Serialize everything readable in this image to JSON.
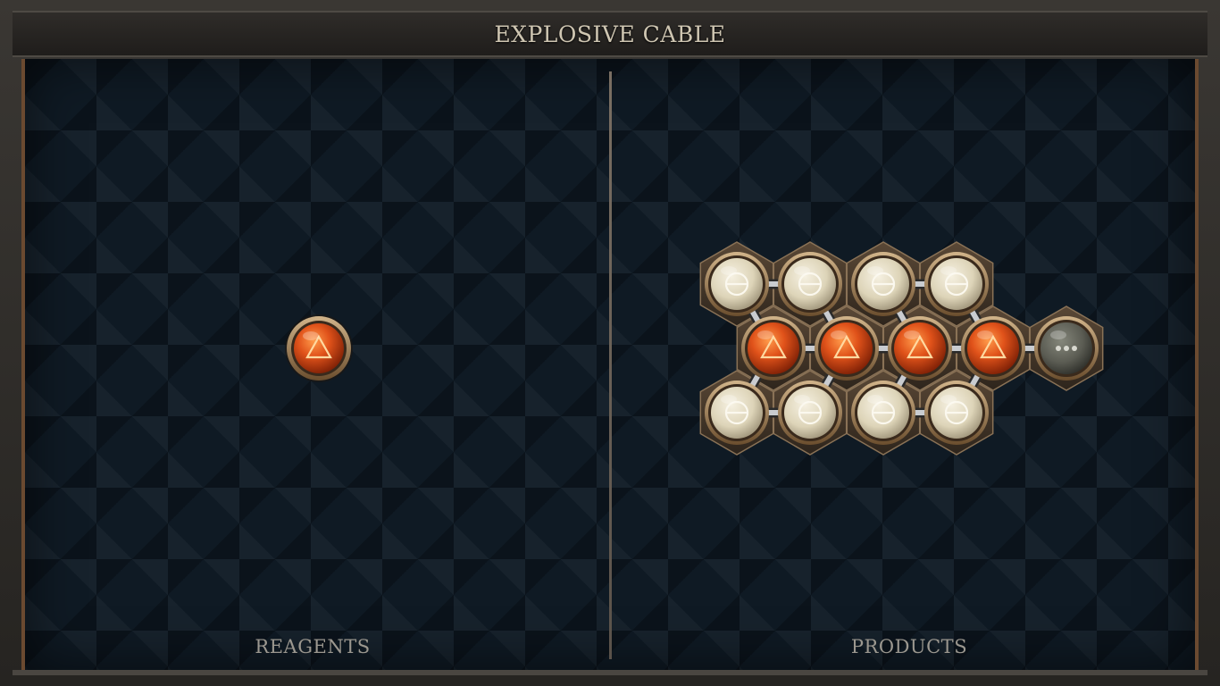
{
  "title": "EXPLOSIVE CABLE",
  "reagents_label": "REAGENTS",
  "products_label": "PRODUCTS",
  "reagents": [
    {
      "element": "fire",
      "symbol": "fire-triangle-icon"
    }
  ],
  "products": {
    "molecule": [
      {
        "element": "salt",
        "symbol": "salt-circle-icon"
      },
      {
        "element": "fire",
        "symbol": "fire-triangle-icon"
      },
      {
        "element": "unknown",
        "symbol": "ellipsis-icon"
      }
    ]
  },
  "colors": {
    "fire": "#e0521a",
    "salt": "#e4dcc4",
    "unknown": "#5b5c53",
    "bond": "#c9ccd0",
    "frame_accent": "#6b4a30"
  }
}
